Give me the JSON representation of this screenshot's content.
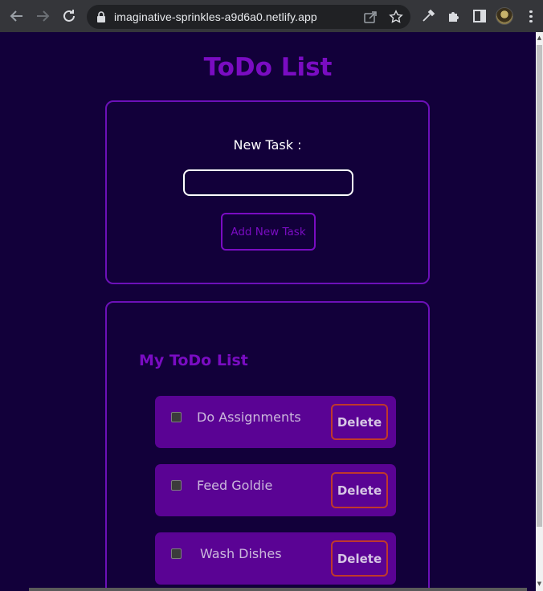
{
  "browser": {
    "url": "imaginative-sprinkles-a9d6a0.netlify.app",
    "icons": [
      "back-icon",
      "forward-icon",
      "reload-icon",
      "lock-icon",
      "share-icon",
      "bookmark-star-icon",
      "eyedropper-icon",
      "extensions-icon",
      "side-panel-icon",
      "profile-avatar",
      "menu-kebab-icon"
    ]
  },
  "page": {
    "title": "ToDo List",
    "new_task": {
      "label": "New Task :",
      "input_value": "",
      "add_button": "Add New Task"
    },
    "list": {
      "title": "My ToDo List",
      "items": [
        {
          "text": "Do Assignments",
          "checked": false,
          "delete_label": "Delete"
        },
        {
          "text": "Feed Goldie",
          "checked": false,
          "delete_label": "Delete"
        },
        {
          "text": "Wash Dishes",
          "checked": false,
          "delete_label": "Delete"
        }
      ]
    },
    "colors": {
      "background": "#12003a",
      "accent": "#7a0cc2",
      "item_bg": "#5a0394",
      "delete_border": "#c0392b"
    }
  }
}
